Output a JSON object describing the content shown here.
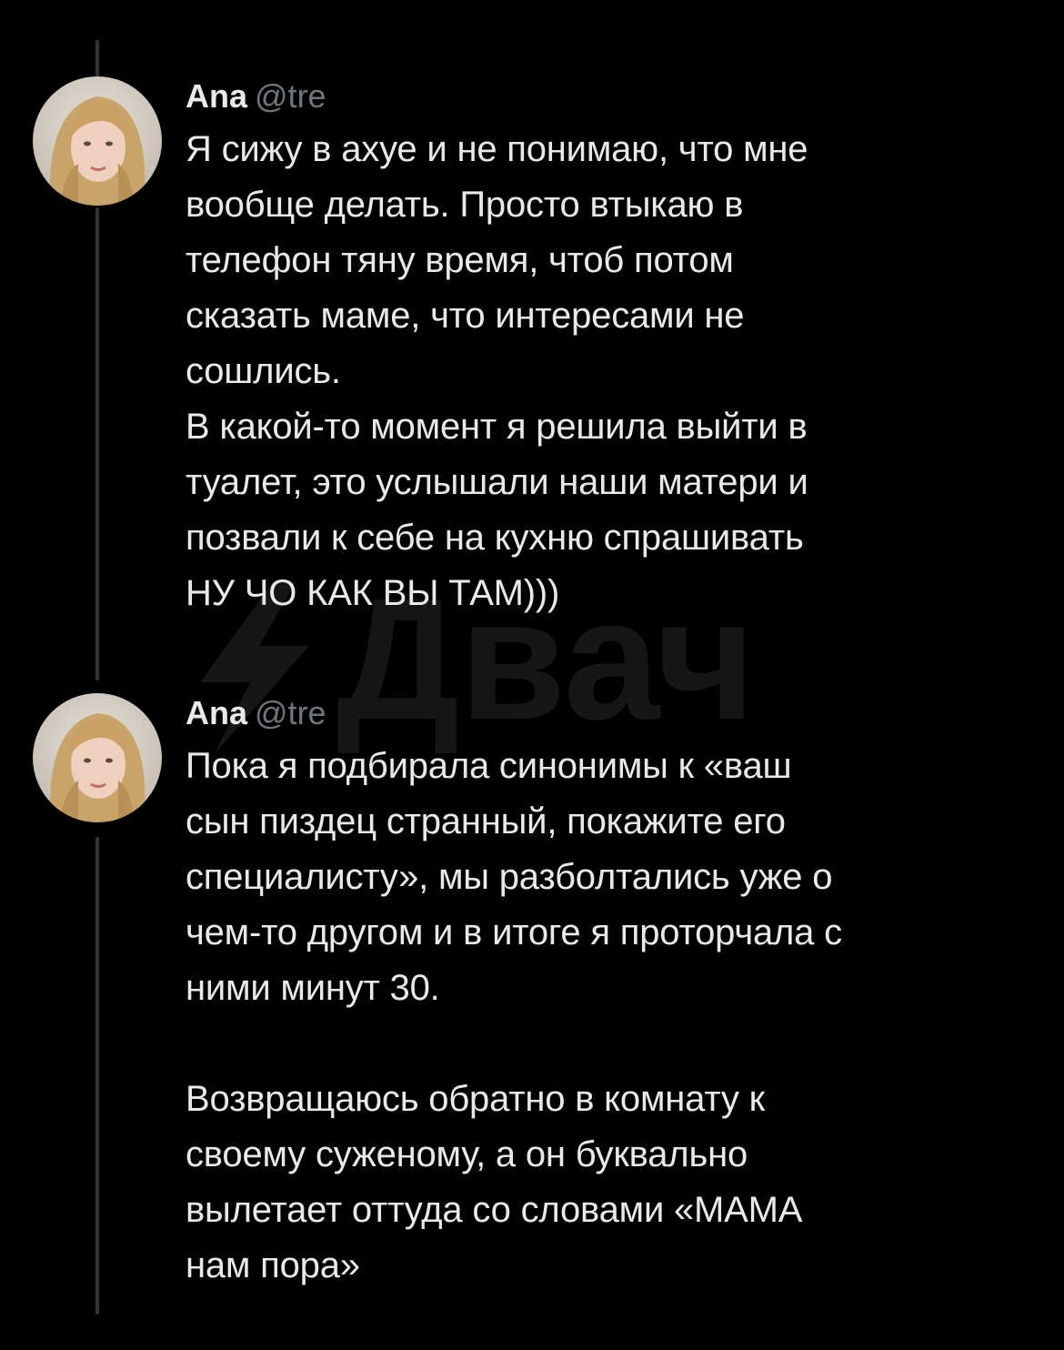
{
  "watermark": {
    "text": "Двач"
  },
  "posts": [
    {
      "author": {
        "name": "Ana",
        "handle": "@tre",
        "avatar_icon": "avatar-photo"
      },
      "text": "Я сижу в ахуе и не понимаю, что мне\nвообще делать. Просто втыкаю в\nтелефон тяну время, чтоб потом\nсказать маме, что интересами не\nсошлись.\nВ какой-то момент я решила выйти в\nтуалет, это услышали наши матери и\nпозвали к себе на кухню спрашивать\nНУ ЧО КАК ВЫ ТАМ)))"
    },
    {
      "author": {
        "name": "Ana",
        "handle": "@tre",
        "avatar_icon": "avatar-photo"
      },
      "text": "Пока я подбирала синонимы к «ваш\nсын пиздец странный, покажите его\nспециалисту», мы разболтались уже о\nчем-то другом и в итоге я проторчала с\nними минут 30.\n\nВозвращаюсь обратно в комнату к\nсвоему суженому, а он буквально\nвылетает оттуда со словами «МАМА\nнам пора»"
    }
  ],
  "colors": {
    "background": "#000000",
    "text": "#e7e9ea",
    "handle": "#71767b",
    "thread_line": "#333639"
  }
}
